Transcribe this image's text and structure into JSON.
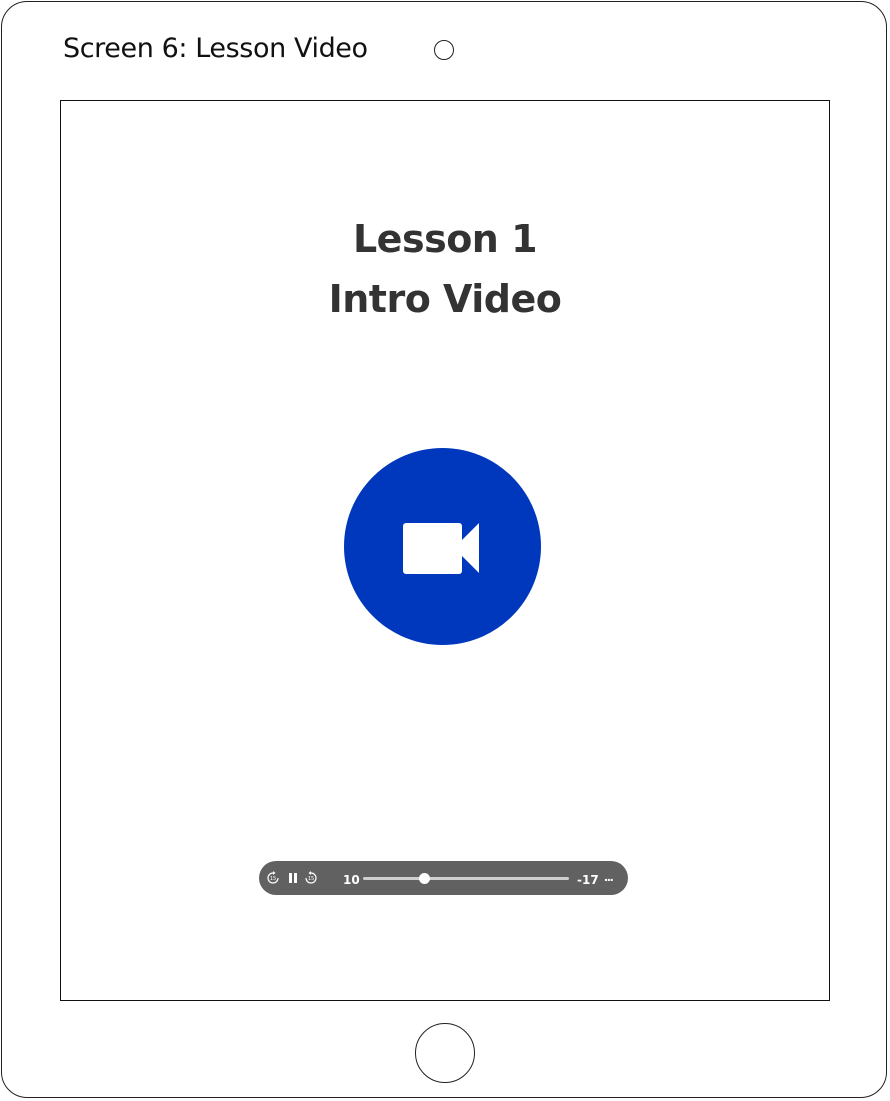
{
  "header": {
    "screen_label": "Screen 6: Lesson Video"
  },
  "lesson": {
    "title_line1": "Lesson 1",
    "title_line2": "Intro Video"
  },
  "video": {
    "icon": "video-camera-icon",
    "accent_color": "#0038bd"
  },
  "player": {
    "rewind_label": "15",
    "forward_label": "15",
    "elapsed": "10",
    "remaining": "-17",
    "progress": 0.3,
    "more_label": "..."
  }
}
